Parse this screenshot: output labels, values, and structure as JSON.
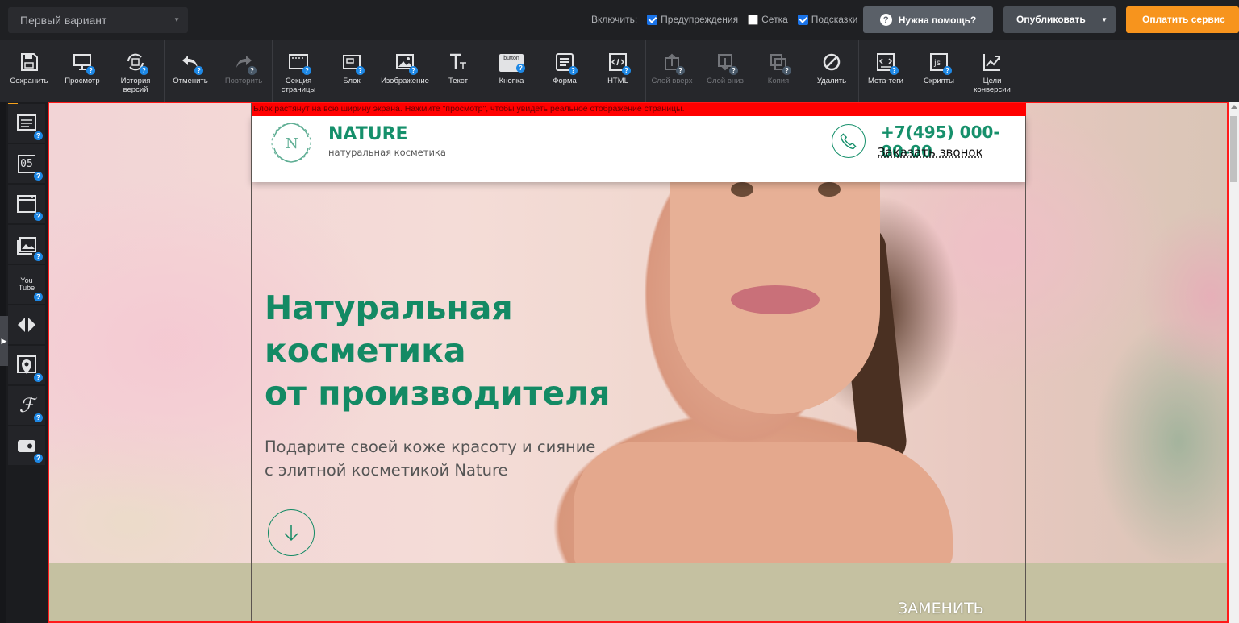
{
  "topbar": {
    "variant": "Первый вариант",
    "enable_label": "Включить:",
    "toggles": [
      {
        "label": "Предупреждения",
        "checked": true
      },
      {
        "label": "Сетка",
        "checked": false
      },
      {
        "label": "Подсказки",
        "checked": true
      }
    ],
    "help_label": "Нужна помощь?",
    "publish_label": "Опубликовать",
    "pay_label": "Оплатить сервис"
  },
  "toolbar": {
    "tools": [
      {
        "label": "Сохранить",
        "icon": "save-icon",
        "enabled": true
      },
      {
        "label": "Просмотр",
        "icon": "preview-icon",
        "enabled": true
      },
      {
        "label": "История версий",
        "icon": "history-icon",
        "enabled": true
      },
      {
        "label": "Отменить",
        "icon": "undo-icon",
        "enabled": true
      },
      {
        "label": "Повторить",
        "icon": "redo-icon",
        "enabled": false
      },
      {
        "label": "Секция страницы",
        "icon": "section-icon",
        "enabled": true
      },
      {
        "label": "Блок",
        "icon": "block-icon",
        "enabled": true
      },
      {
        "label": "Изображение",
        "icon": "image-icon",
        "enabled": true
      },
      {
        "label": "Текст",
        "icon": "text-icon",
        "enabled": true
      },
      {
        "label": "Кнопка",
        "icon": "button-icon",
        "enabled": true
      },
      {
        "label": "Форма",
        "icon": "form-icon",
        "enabled": true
      },
      {
        "label": "HTML",
        "icon": "html-icon",
        "enabled": true
      },
      {
        "label": "Слой вверх",
        "icon": "layer-up-icon",
        "enabled": false
      },
      {
        "label": "Слой вниз",
        "icon": "layer-down-icon",
        "enabled": false
      },
      {
        "label": "Копия",
        "icon": "copy-icon",
        "enabled": false
      },
      {
        "label": "Удалить",
        "icon": "delete-icon",
        "enabled": true
      },
      {
        "label": "Мета-теги",
        "icon": "meta-tags-icon",
        "enabled": true
      },
      {
        "label": "Скрипты",
        "icon": "scripts-icon",
        "enabled": true
      },
      {
        "label": "Цели конверсии",
        "icon": "conversion-icon",
        "enabled": true
      }
    ],
    "button_icon_text": "button"
  },
  "sidebar": {
    "icons": [
      "form-block-icon",
      "timer-icon",
      "popup-icon",
      "gallery-icon",
      "youtube-icon",
      "slider-icon",
      "map-pin-icon",
      "font-icon",
      "widget-icon"
    ],
    "timer_text": "05",
    "youtube_text": "You Tube"
  },
  "canvas": {
    "warning": "Блок растянут на всю ширину экрана. Нажмите \"просмотр\", чтобы увидеть реальное отображение страницы.",
    "logo_letter": "N",
    "brand": "NATURE",
    "tagline": "натуральная косметика",
    "phone": "+7(495) 000-00-00",
    "callback": "Заказать звонок",
    "headline_1": "Натуральная",
    "headline_2": "косметика",
    "headline_3": "от производителя",
    "sub_1": "Подарите своей коже красоту и сияние",
    "sub_2": "с элитной косметикой Nature",
    "replace_label": "ЗАМЕНИТЬ"
  },
  "colors": {
    "accent_green": "#16906b",
    "pay_orange": "#f7941d",
    "warning_red": "#ff0000",
    "checkbox_blue": "#1a73e8"
  }
}
